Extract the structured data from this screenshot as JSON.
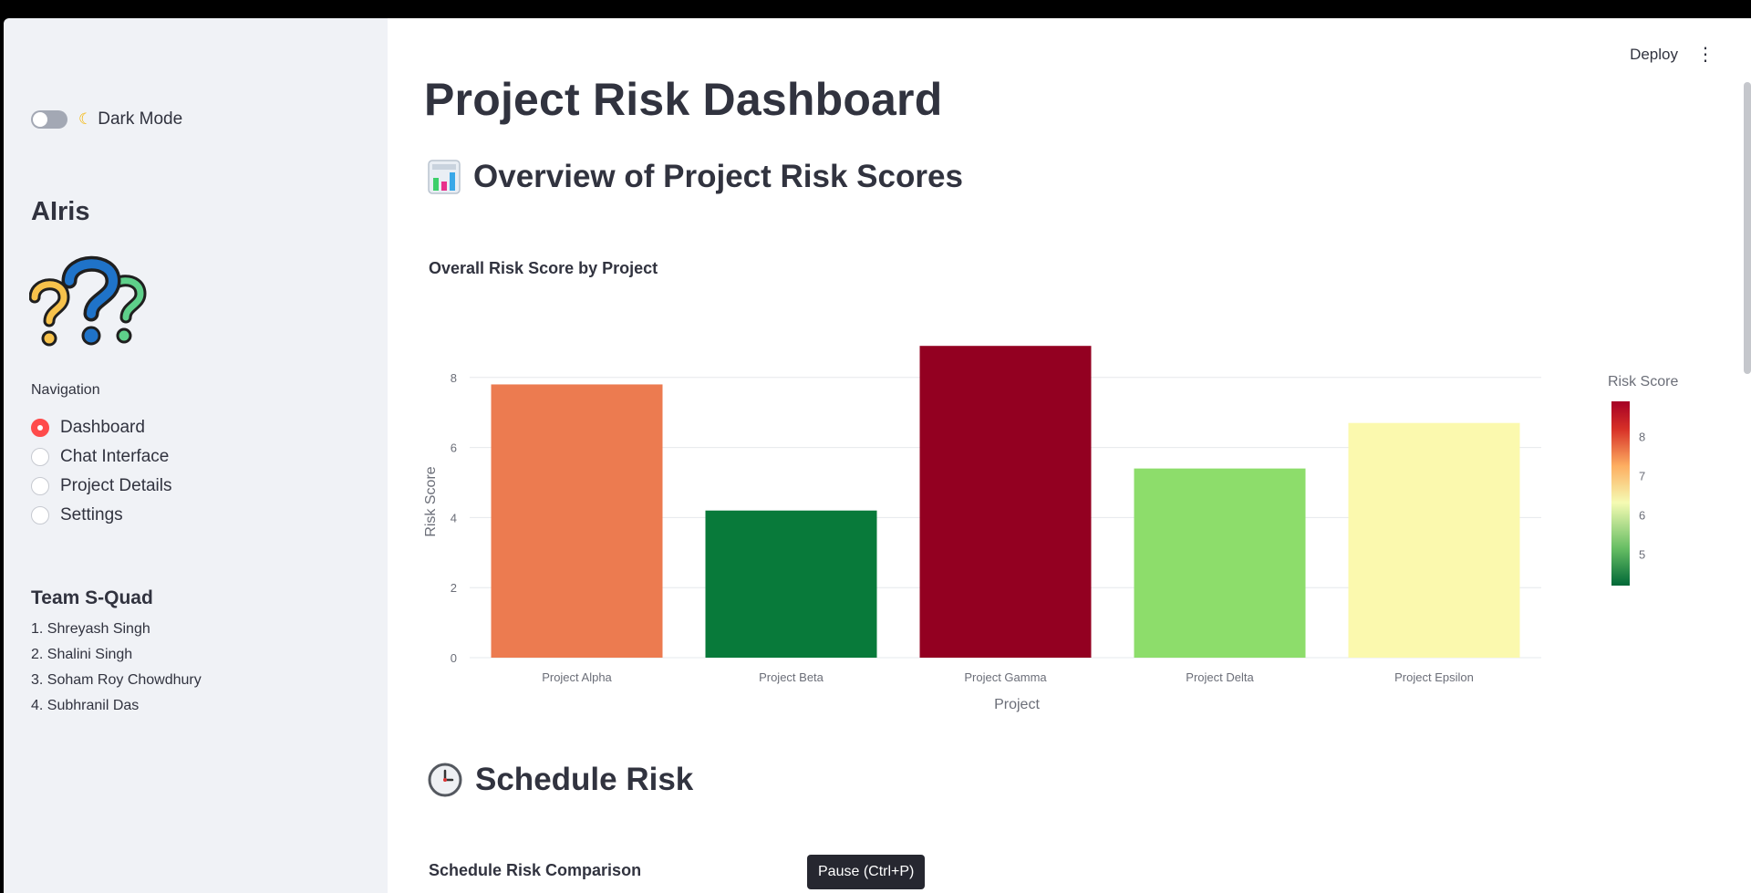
{
  "sidebar": {
    "dark_mode_label": "Dark Mode",
    "moon_icon": "crescent-moon-icon",
    "brand": "AIris",
    "nav_title": "Navigation",
    "nav_items": [
      {
        "label": "Dashboard",
        "selected": true
      },
      {
        "label": "Chat Interface",
        "selected": false
      },
      {
        "label": "Project Details",
        "selected": false
      },
      {
        "label": "Settings",
        "selected": false
      }
    ],
    "team_title": "Team S-Quad",
    "team_members": [
      "1. Shreyash Singh",
      "2. Shalini Singh",
      "3. Soham Roy Chowdhury",
      "4. Subhranil Das"
    ]
  },
  "header": {
    "deploy_label": "Deploy",
    "menu_icon": "kebab-menu-icon"
  },
  "main": {
    "title": "Project Risk Dashboard",
    "section1": {
      "icon": "bar-chart-icon",
      "heading": "Overview of Project Risk Scores"
    },
    "chart1_title": "Overall Risk Score by Project",
    "section2": {
      "icon": "clock-icon",
      "heading": "Schedule Risk"
    },
    "chart2_title": "Schedule Risk Comparison"
  },
  "tooltip": "Pause (Ctrl+P)",
  "colors": {
    "accent": "#ff4b4b",
    "sidebar_bg": "#f0f2f6",
    "text": "#31333f"
  },
  "chart_data": {
    "type": "bar",
    "categories": [
      "Project Alpha",
      "Project Beta",
      "Project Gamma",
      "Project Delta",
      "Project Epsilon"
    ],
    "values": [
      7.8,
      4.2,
      8.9,
      5.4,
      6.7
    ],
    "colors": [
      "#ec7b50",
      "#087a3a",
      "#930021",
      "#8ddd6b",
      "#fbf9ae"
    ],
    "xlabel": "Project",
    "ylabel": "Risk Score",
    "ylim": [
      0,
      9.4
    ],
    "yticks": [
      0,
      2,
      4,
      6,
      8
    ],
    "grid": true,
    "colorbar": {
      "title": "Risk Score",
      "range": [
        4.2,
        8.9
      ],
      "ticks": [
        5,
        6,
        7,
        8
      ]
    }
  }
}
